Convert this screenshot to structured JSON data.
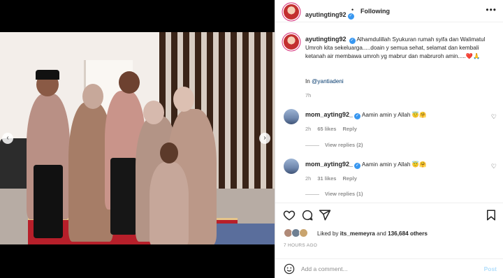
{
  "header": {
    "username": "ayutingting92",
    "separator": "•",
    "follow_status": "Following",
    "more_icon": "more-horizontal-icon"
  },
  "caption": {
    "username": "ayutingting92",
    "text": "Alhamdulillah Syukuran rumah syifa dan Walimatul Umroh kita sekeluarga.....doain y semua sehat, selamat dan kembali ketanah air membawa umroh yg mabrur dan mabruroh amin.....❤️🙏",
    "in_prefix": "In ",
    "tagged": "@yantiadeni",
    "time": "7h"
  },
  "comments": [
    {
      "username": "mom_ayting92_",
      "text": "Aamin amin y Allah 😇🤗",
      "time": "2h",
      "likes": "65 likes",
      "reply": "Reply",
      "view_replies": "View replies (2)"
    },
    {
      "username": "mom_ayting92_",
      "text": "Aamin amin y Allah 😇🤗",
      "time": "2h",
      "likes": "31 likes",
      "reply": "Reply",
      "view_replies": "View replies (1)"
    }
  ],
  "likes": {
    "prefix": "Liked by ",
    "user": "its_memeyra",
    "and": " and ",
    "count": "136,684 others"
  },
  "post_time": "7 HOURS AGO",
  "add_comment": {
    "placeholder": "Add a comment...",
    "post_label": "Post"
  },
  "colors": {
    "verified": "#3897f0",
    "link": "#00376b",
    "post_disabled": "#b2dffc"
  }
}
